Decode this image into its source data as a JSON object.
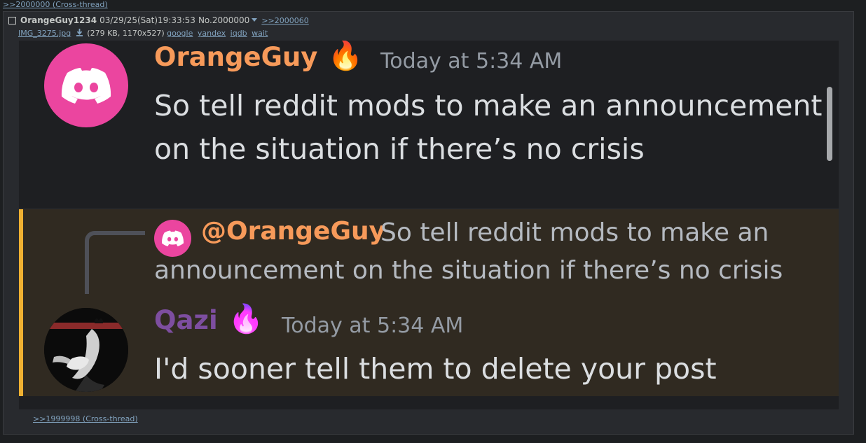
{
  "top_crossref": ">>2000000 (Cross-thread)",
  "post": {
    "name": "OrangeGuy1234",
    "date": "03/29/25(Sat)19:33:53",
    "number": "No.2000000",
    "backlink": ">>2000060",
    "file": {
      "filename": "IMG_3275.jpg",
      "details": "(279 KB, 1170x527)",
      "search_links": [
        "google",
        "yandex",
        "iqdb",
        "wait"
      ]
    }
  },
  "screenshot": {
    "message1": {
      "username": "OrangeGuy",
      "emoji": "🔥",
      "timestamp": "Today at 5:34 AM",
      "line1": "So tell reddit mods to make an announcement",
      "line2": "on the situation if there’s no crisis"
    },
    "reply": {
      "mention": "@OrangeGuy",
      "line1": "So tell reddit mods to make an",
      "line2": "announcement on the situation if there’s no crisis"
    },
    "message2": {
      "username": "Qazi",
      "emoji": "🔥",
      "timestamp": "Today at 5:34 AM",
      "text": "I'd sooner tell them to delete your post"
    },
    "colors": {
      "reply_bar": "#f0b132",
      "orangeguy_name": "#f79a5a",
      "qazi_name": "#7d4ea0",
      "discord_pink": "#eb459f"
    }
  },
  "bottom_crossref": ">>1999998 (Cross-thread)"
}
